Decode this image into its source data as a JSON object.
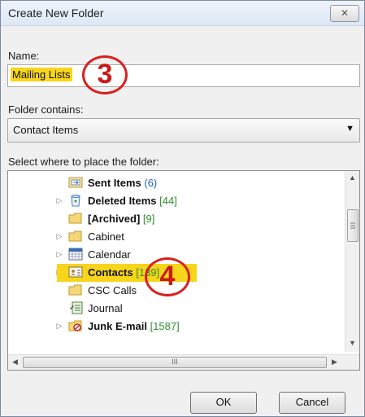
{
  "window": {
    "title": "Create New Folder",
    "close_glyph": "✕"
  },
  "name_field": {
    "label": "Name:",
    "value": "Mailing Lists"
  },
  "contains": {
    "label": "Folder contains:",
    "selected": "Contact Items"
  },
  "tree": {
    "label": "Select where to place the folder:",
    "items": [
      {
        "label": "Sent Items",
        "count": "(6)",
        "icon": "sent-items-icon"
      },
      {
        "label": "Deleted Items",
        "count": "[44]",
        "icon": "recycle-bin-icon"
      },
      {
        "label": "[Archived]",
        "count": "[9]",
        "icon": "folder-icon"
      },
      {
        "label": "Cabinet",
        "count": "",
        "icon": "folder-icon"
      },
      {
        "label": "Calendar",
        "count": "",
        "icon": "calendar-icon"
      },
      {
        "label": "Contacts",
        "count": "[139]",
        "icon": "contacts-icon"
      },
      {
        "label": "CSC Calls",
        "count": "",
        "icon": "folder-icon"
      },
      {
        "label": "Journal",
        "count": "",
        "icon": "journal-icon"
      },
      {
        "label": "Junk E-mail",
        "count": "[1587]",
        "icon": "junk-mail-icon"
      }
    ],
    "hscroll_grip": "III"
  },
  "annotations": {
    "step_3": "3",
    "step_4": "4"
  },
  "buttons": {
    "ok": "OK",
    "cancel": "Cancel"
  },
  "colors": {
    "highlight": "#f7d51b",
    "annotation": "#d92020",
    "count_blue": "#1f5fbf",
    "count_green": "#2f8f2f"
  }
}
